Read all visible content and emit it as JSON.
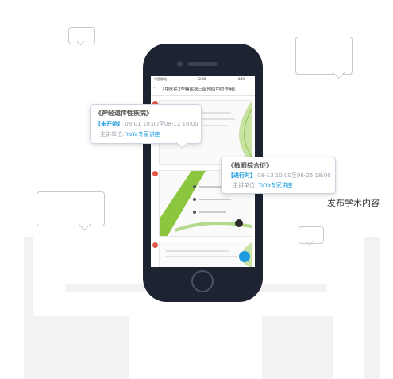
{
  "phone": {
    "status_bar": {
      "carrier": "中国移动",
      "time": "12:36",
      "battery": "84%"
    },
    "screen_title": "《中医在2型糖尿病三级预防中的作用》"
  },
  "cards": [
    {
      "title": "《神经遗传性疾病》",
      "status": "【未开始】",
      "time_range": "08-01 10:00至08-12 18:00",
      "host_label": "主讲单位:",
      "host_name": "YaYa专家讲座"
    },
    {
      "title": "《敏眼综合征》",
      "status": "【进行时】",
      "time_range": "08-13 10:00至08-25 18:00",
      "host_label": "主讲单位:",
      "host_name": "YaYa专家讲座"
    }
  ],
  "caption": "发布学术内容",
  "colors": {
    "accent": "#1e9be0",
    "phone_body": "#1d2331",
    "leaf_green": "#8cc63f"
  }
}
